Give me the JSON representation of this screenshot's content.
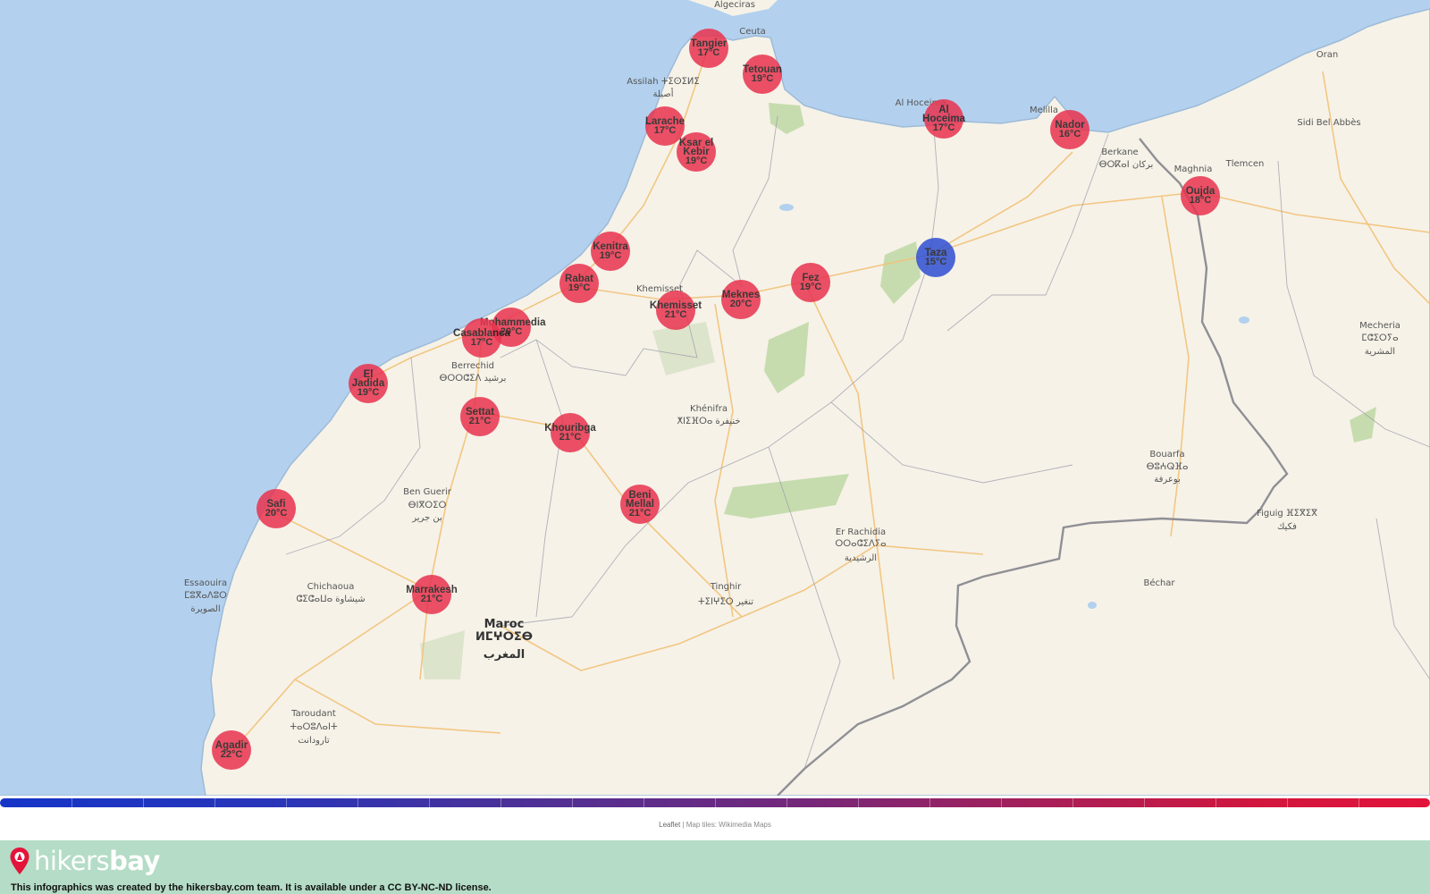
{
  "map": {
    "colors": {
      "sea": "#b3d1ee",
      "land": "#f6f2e8",
      "forest": "#c6dcae",
      "road": "#f2c278",
      "border": "#8f8f95",
      "warm_marker": "#e8334f",
      "cool_marker": "#2f4fd2"
    },
    "places": [
      {
        "text": "Algeciras",
        "cls": ""
      },
      {
        "text": "Ceuta",
        "cls": ""
      },
      {
        "text": "Assilah ⵜⵉⵙⵉⵍⵉ",
        "cls": ""
      },
      {
        "text": "أصيلة",
        "cls": ""
      },
      {
        "text": "Al Hoceima",
        "cls": ""
      },
      {
        "text": "Melilla",
        "cls": ""
      },
      {
        "text": "Oran",
        "cls": ""
      },
      {
        "text": "Sidi Bel Abbès",
        "cls": ""
      },
      {
        "text": "Tlemcen",
        "cls": ""
      },
      {
        "text": "Maghnia",
        "cls": ""
      },
      {
        "text": "Berkane",
        "cls": ""
      },
      {
        "text": "ⴱⵔⴽⴰⵏ بركان",
        "cls": ""
      },
      {
        "text": "Berrechid",
        "cls": ""
      },
      {
        "text": "ⴱⵔⵔⵛⵉⴷ برشيد",
        "cls": ""
      },
      {
        "text": "Khénifra",
        "cls": ""
      },
      {
        "text": "ⵅⵏⵉⴼⵔⴰ خنيفرة",
        "cls": ""
      },
      {
        "text": "Ben Guerir",
        "cls": ""
      },
      {
        "text": "ⴱⵏⴳⵔⵉⵔ",
        "cls": ""
      },
      {
        "text": "بن جرير",
        "cls": ""
      },
      {
        "text": "Essaouira",
        "cls": ""
      },
      {
        "text": "ⵎⵓⴳⴰⴷⵓⵔ",
        "cls": ""
      },
      {
        "text": "الصويرة",
        "cls": ""
      },
      {
        "text": "Chichaoua",
        "cls": ""
      },
      {
        "text": "ⵛⵉⵛⴰⵡⴰ شيشاوة",
        "cls": ""
      },
      {
        "text": "Maroc",
        "cls": "country"
      },
      {
        "text": "ⵍⵎⵖⵔⵉⴱ",
        "cls": "country"
      },
      {
        "text": "المغرب",
        "cls": "country"
      },
      {
        "text": "Taroudant",
        "cls": ""
      },
      {
        "text": "ⵜⴰⵔⵓⴷⴰⵏⵜ",
        "cls": ""
      },
      {
        "text": "تارودانت",
        "cls": ""
      },
      {
        "text": "Tinghir",
        "cls": ""
      },
      {
        "text": "ⵜⵉⵏⵖⵉⵔ تنغير",
        "cls": ""
      },
      {
        "text": "Er Rachidia",
        "cls": ""
      },
      {
        "text": "ⵔⵔⴰⵛⵉⴷⵢⴰ",
        "cls": ""
      },
      {
        "text": "الرشيدية",
        "cls": ""
      },
      {
        "text": "Bouarfa",
        "cls": ""
      },
      {
        "text": "ⴱⵓⵄⵕⴼⴰ",
        "cls": ""
      },
      {
        "text": "بوعرفة",
        "cls": ""
      },
      {
        "text": "Figuig ⴼⵉⴳⵉⴳ",
        "cls": ""
      },
      {
        "text": "فكيك",
        "cls": ""
      },
      {
        "text": "Béchar",
        "cls": ""
      },
      {
        "text": "Mecheria",
        "cls": ""
      },
      {
        "text": "ⵎⵛⵉⵔⵢⴰ",
        "cls": ""
      },
      {
        "text": "المشرية",
        "cls": ""
      },
      {
        "text": "Khemisset",
        "cls": ""
      }
    ],
    "cities": [
      {
        "name": "Tangier",
        "temp": "17°C",
        "t": 17
      },
      {
        "name": "Tetouan",
        "temp": "19°C",
        "t": 19
      },
      {
        "name": "Larache",
        "temp": "17°C",
        "t": 17
      },
      {
        "name": "Ksar el Kebir",
        "temp": "19°C",
        "t": 19
      },
      {
        "name": "Al Hoceima",
        "temp": "17°C",
        "t": 17
      },
      {
        "name": "Nador",
        "temp": "16°C",
        "t": 16
      },
      {
        "name": "Oujda",
        "temp": "18°C",
        "t": 18
      },
      {
        "name": "Kenitra",
        "temp": "19°C",
        "t": 19
      },
      {
        "name": "Rabat",
        "temp": "19°C",
        "t": 19
      },
      {
        "name": "Taza",
        "temp": "15°C",
        "t": 15
      },
      {
        "name": "Fez",
        "temp": "19°C",
        "t": 19
      },
      {
        "name": "Meknes",
        "temp": "20°C",
        "t": 20
      },
      {
        "name": "Khemisset",
        "temp": "21°C",
        "t": 21
      },
      {
        "name": "Mohammedia",
        "temp": "20°C",
        "t": 20
      },
      {
        "name": "Casablanca",
        "temp": "17°C",
        "t": 17
      },
      {
        "name": "El Jadida",
        "temp": "19°C",
        "t": 19
      },
      {
        "name": "Settat",
        "temp": "21°C",
        "t": 21
      },
      {
        "name": "Khouribga",
        "temp": "21°C",
        "t": 21
      },
      {
        "name": "Beni Mellal",
        "temp": "21°C",
        "t": 21
      },
      {
        "name": "Safi",
        "temp": "20°C",
        "t": 20
      },
      {
        "name": "Marrakesh",
        "temp": "21°C",
        "t": 21
      },
      {
        "name": "Agadir",
        "temp": "22°C",
        "t": 22
      }
    ]
  },
  "attribution": {
    "leaflet": "Leaflet",
    "sep": " | ",
    "tiles": "Map tiles: Wikimedia Maps"
  },
  "footer": {
    "brand_a": "hikers",
    "brand_b": "bay",
    "license": "This infographics was created by the hikersbay.com team. It is available under a CC BY-NC-ND license."
  }
}
